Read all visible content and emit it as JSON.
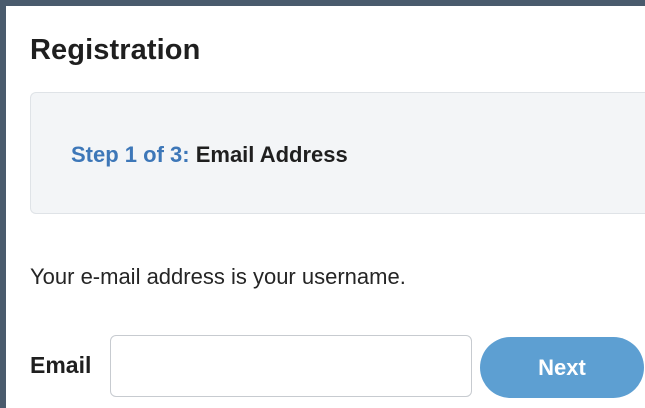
{
  "form": {
    "title": "Registration",
    "step": {
      "prefix": "Step 1 of 3:",
      "name": "Email Address"
    },
    "info_text": "Your e-mail address is your username.",
    "email": {
      "label": "Email",
      "value": "",
      "placeholder": ""
    },
    "next_label": "Next"
  },
  "colors": {
    "frame": "#4a5b6d",
    "step_prefix": "#3d77b8",
    "button": "#5d9fd2",
    "step_box": "#f3f5f7"
  }
}
